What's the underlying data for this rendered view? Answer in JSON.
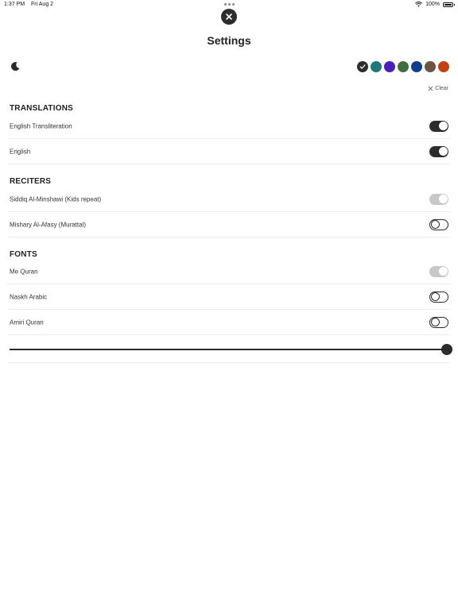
{
  "status_bar": {
    "time": "1:37 PM",
    "date": "Fri Aug 2",
    "battery": "100%"
  },
  "header": {
    "title": "Settings"
  },
  "theme": {
    "icon": "moon-icon"
  },
  "colors": {
    "swatches": [
      "#2d2d2d",
      "#1d7a7a",
      "#4a1fb8",
      "#3f6e3f",
      "#0f3f8f",
      "#6b5440",
      "#c4420f"
    ],
    "selected_index": 0
  },
  "clear": {
    "label": "Clear"
  },
  "translations": {
    "title": "TRANSLATIONS",
    "items": [
      {
        "label": "English Transliteration",
        "state": "on"
      },
      {
        "label": "English",
        "state": "on"
      }
    ]
  },
  "reciters": {
    "title": "RECITERS",
    "items": [
      {
        "label": "Siddiq Al-Minshawi (Kids repeat)",
        "state": "disabled"
      },
      {
        "label": "Mishary Al-Afasy (Murattal)",
        "state": "off"
      }
    ]
  },
  "fonts": {
    "title": "FONTS",
    "items": [
      {
        "label": "Me Quran",
        "state": "disabled"
      },
      {
        "label": "Naskh Arabic",
        "state": "off"
      },
      {
        "label": "Amiri Quran",
        "state": "off"
      }
    ],
    "size_slider": {
      "value": 1.0
    }
  }
}
